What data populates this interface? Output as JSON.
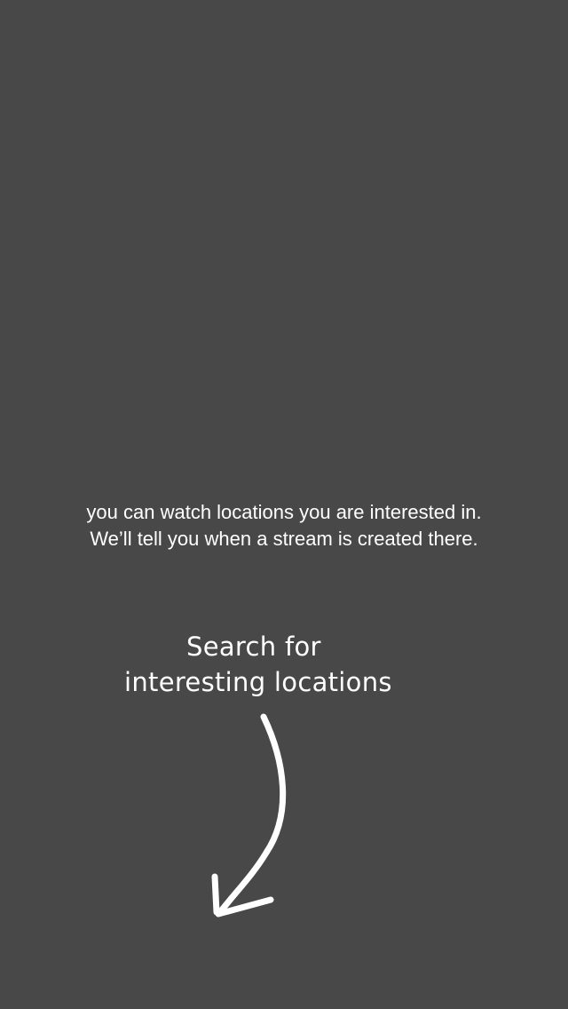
{
  "onboarding": {
    "info_line_1": "you can watch locations you are interested in.",
    "info_line_2": "We’ll tell you when a stream is created there.",
    "hint_line_1": "Search for",
    "hint_line_2": "interesting locations",
    "arrow_icon": "hand-drawn-arrow-down-left-icon",
    "background_color": "#484848",
    "text_color": "#ffffff"
  }
}
